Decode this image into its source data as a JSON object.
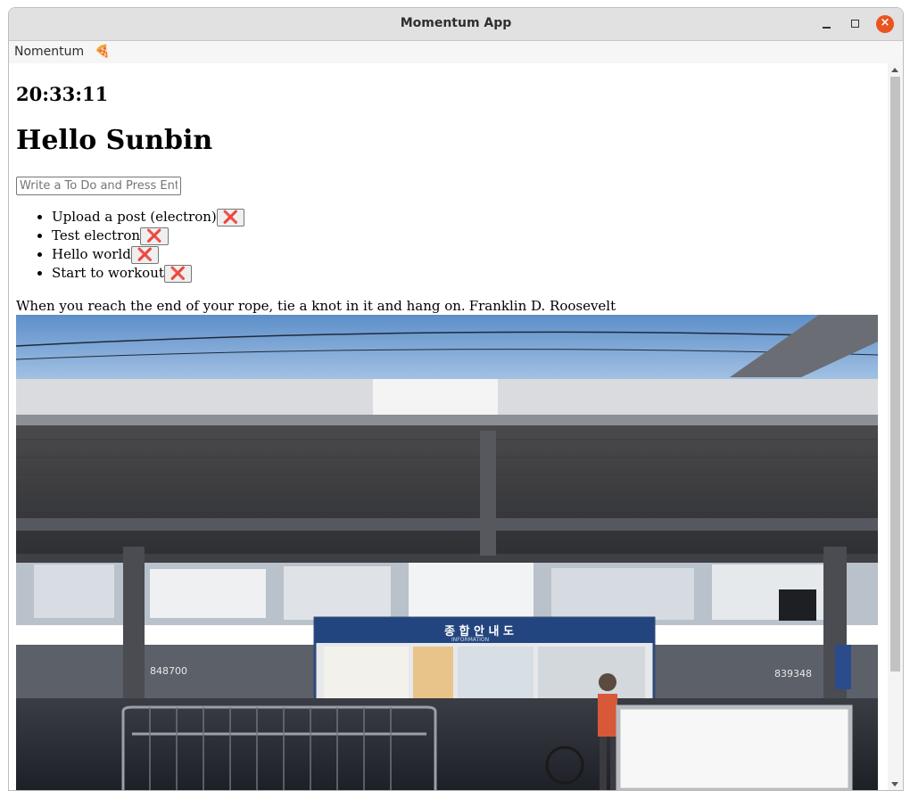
{
  "window": {
    "title": "Momentum App"
  },
  "menubar": {
    "items": [
      "Nomentum",
      "🍕"
    ]
  },
  "clock": "20:33:11",
  "greeting": "Hello Sunbin",
  "todo": {
    "placeholder": "Write a To Do and Press Enter",
    "items": [
      {
        "text": "Upload a post (electron)",
        "delete_label": "❌"
      },
      {
        "text": "Test electron",
        "delete_label": "❌"
      },
      {
        "text": "Hello world",
        "delete_label": "❌"
      },
      {
        "text": "Start to workout",
        "delete_label": "❌"
      }
    ]
  },
  "quote": {
    "text": "When you reach the end of your rope, tie a knot in it and hang on.",
    "author": "Franklin D. Roosevelt"
  },
  "photo": {
    "signs": {
      "info_board": "종 합 안 내 도",
      "info_sub": "INFORMATION",
      "tanker_left": "848700",
      "tanker_right": "839348"
    }
  },
  "colors": {
    "close_button": "#e95420",
    "titlebar": "#e1e1e1",
    "delete_icon": "#d7232b"
  }
}
